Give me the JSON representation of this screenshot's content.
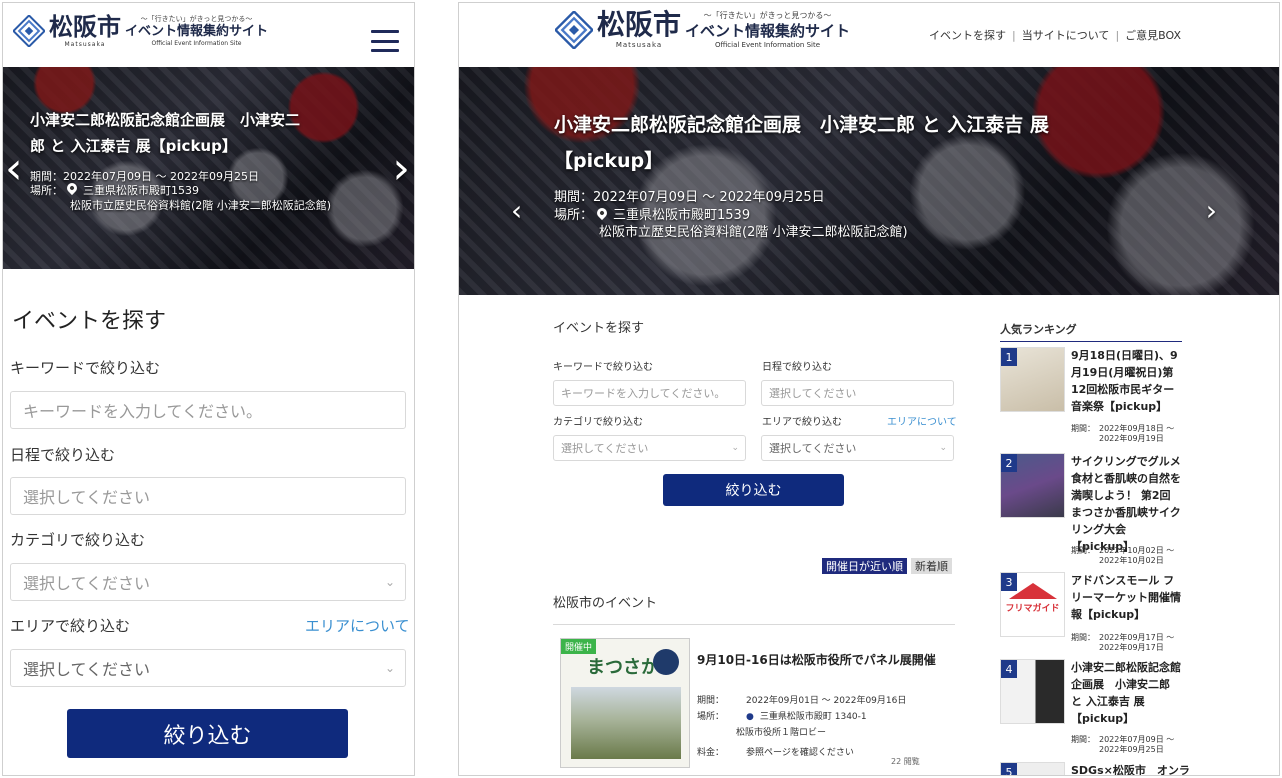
{
  "logo": {
    "kanji": "松阪市",
    "romaji": "Matsusaka",
    "tagline": "～「行きたい」がきっと見つかる～",
    "site_name": "イベント情報集約サイト",
    "english": "Official Event Information Site"
  },
  "nav": {
    "items": [
      {
        "label": "イベントを探す"
      },
      {
        "label": "当サイトについて"
      },
      {
        "label": "ご意見BOX"
      }
    ]
  },
  "hero": {
    "title": "小津安二郎松阪記念館企画展　小津安二郎 と 入江泰吉 展【pickup】",
    "mobile_title_1": "小津安二郎松阪記念館企画展　小津安二",
    "mobile_title_2": "郎 と 入江泰吉 展【pickup】",
    "desktop_title_1": "小津安二郎松阪記念館企画展　小津安二郎 と 入江泰吉 展",
    "desktop_title_2": "【pickup】",
    "period": "期間：2022年07月09日 ～ 2022年09月25日",
    "place_label": "場所：",
    "place_address": "三重県松阪市殿町1539",
    "place_venue": "松阪市立歴史民俗資料館(2階 小津安二郎松阪記念館)",
    "prev": "‹",
    "next": "›"
  },
  "search": {
    "heading": "イベントを探す",
    "keyword_label": "キーワードで絞り込む",
    "keyword_placeholder": "キーワードを入力してください。",
    "date_label": "日程で絞り込む",
    "date_placeholder": "選択してください",
    "category_label": "カテゴリで絞り込む",
    "category_placeholder": "選択してください",
    "area_label": "エリアで絞り込む",
    "area_placeholder": "選択してください",
    "area_link": "エリアについて",
    "submit": "絞り込む"
  },
  "sort": {
    "near": "開催日が近い順",
    "newest": "新着順"
  },
  "events": {
    "section_title": "松阪市のイベント",
    "items": [
      {
        "title": "9月10日-16日は松阪市役所でパネル展開催",
        "badge": "開催中",
        "thumb_text": "まつさか",
        "period_label": "期間：",
        "period": "2022年09月01日 ～ 2022年09月16日",
        "place_label": "場所：",
        "address": "三重県松阪市殿町 1340-1",
        "venue": "松阪市役所１階ロビー",
        "fee_label": "料金：",
        "fee": "参照ページを確認ください",
        "views": "22 閲覧"
      }
    ]
  },
  "ranking": {
    "title": "人気ランキング",
    "items": [
      {
        "rank": "1",
        "title": "9月18日(日曜日)、9月19日(月曜祝日)第12回松阪市民ギター音楽祭【pickup】",
        "period_label": "期間：",
        "from": "2022年09月18日 ～",
        "to": "2022年09月19日"
      },
      {
        "rank": "2",
        "title": "サイクリングでグルメ食材と香肌峡の自然を満喫しよう！ 第2回 まつさか香肌峡サイクリング大会【pickup】",
        "period_label": "期間：",
        "from": "2022年10月02日 ～",
        "to": "2022年10月02日"
      },
      {
        "rank": "3",
        "title": "アドバンスモール フリーマーケット開催情報【pickup】",
        "thumb_text": "フリマガイド",
        "period_label": "期間：",
        "from": "2022年09月17日 ～",
        "to": "2022年09月17日"
      },
      {
        "rank": "4",
        "title": "小津安二郎松阪記念館企画展　小津安二郎 と 入江泰吉 展【pickup】",
        "period_label": "期間：",
        "from": "2022年07月09日 ～",
        "to": "2022年09月25日"
      },
      {
        "rank": "5",
        "title": "SDGs×松阪市　オンラ"
      }
    ]
  },
  "colors": {
    "brand": "#0f2a7d",
    "link": "#3a8fd0",
    "badge": "#3cb44a"
  }
}
